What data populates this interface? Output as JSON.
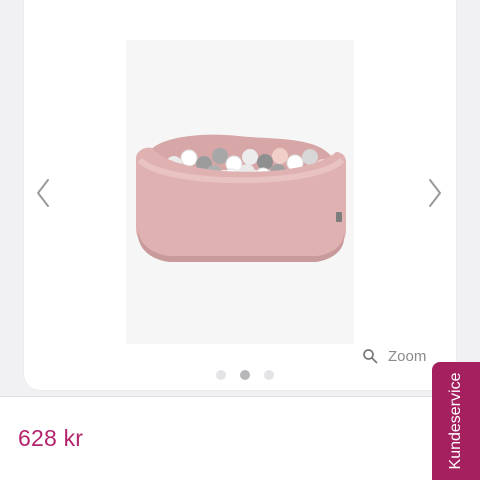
{
  "gallery": {
    "product_image_alt": "Pink ball pit with white, grey and pink balls",
    "zoom_label": "Zoom",
    "slide_count": 3,
    "active_slide": 2,
    "prev_icon": "chevron-left-icon",
    "next_icon": "chevron-right-icon",
    "zoom_icon": "magnifier-icon"
  },
  "product": {
    "price": "628 kr"
  },
  "service_tab": {
    "label": "Kundeservice"
  },
  "colors": {
    "background": "#f1f0f2",
    "card": "#ffffff",
    "price": "#b3246c",
    "service_tab": "#a4205e",
    "pit_pink": "#dfb1b1",
    "dot_active": "#b7b7ba",
    "dot_inactive": "#e4e4e6"
  }
}
